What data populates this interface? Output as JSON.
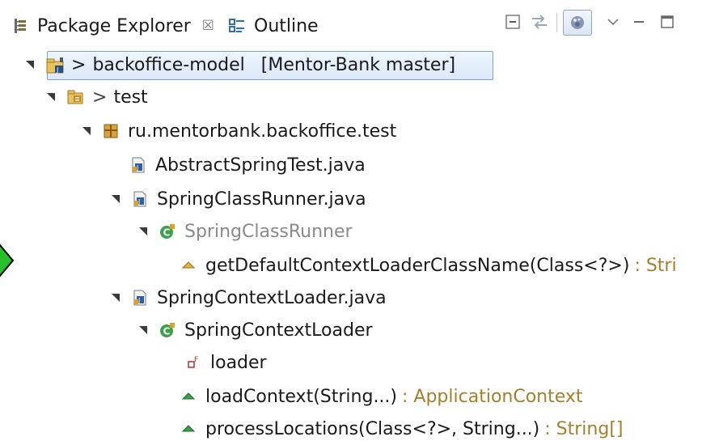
{
  "tabs": {
    "package_explorer": "Package Explorer",
    "close_symbol": "☒",
    "outline": "Outline"
  },
  "tree": {
    "project": {
      "prefix": ">",
      "name": "backoffice-model",
      "repo": "[Mentor-Bank master]"
    },
    "source_folder": {
      "prefix": ">",
      "name": "test"
    },
    "package": {
      "name": "ru.mentorbank.backoffice.test"
    },
    "file1": {
      "name": "AbstractSpringTest.java"
    },
    "file2": {
      "name": "SpringClassRunner.java"
    },
    "class2": {
      "name": "SpringClassRunner"
    },
    "method2": {
      "name": "getDefaultContextLoaderClassName(Class<?>)",
      "return_type": ": Stri"
    },
    "file3": {
      "name": "SpringContextLoader.java"
    },
    "class3": {
      "name": "SpringContextLoader"
    },
    "field3": {
      "name": "loader"
    },
    "method3a": {
      "name": "loadContext(String...)",
      "return_type": ": ApplicationContext"
    },
    "method3b": {
      "name": "processLocations(Class<?>, String...)",
      "return_type": ": String[]"
    }
  },
  "colors": {
    "selection_border": "#7da2ce",
    "type_suffix": "#a67f2a",
    "arrow_green": "#27c02a"
  }
}
